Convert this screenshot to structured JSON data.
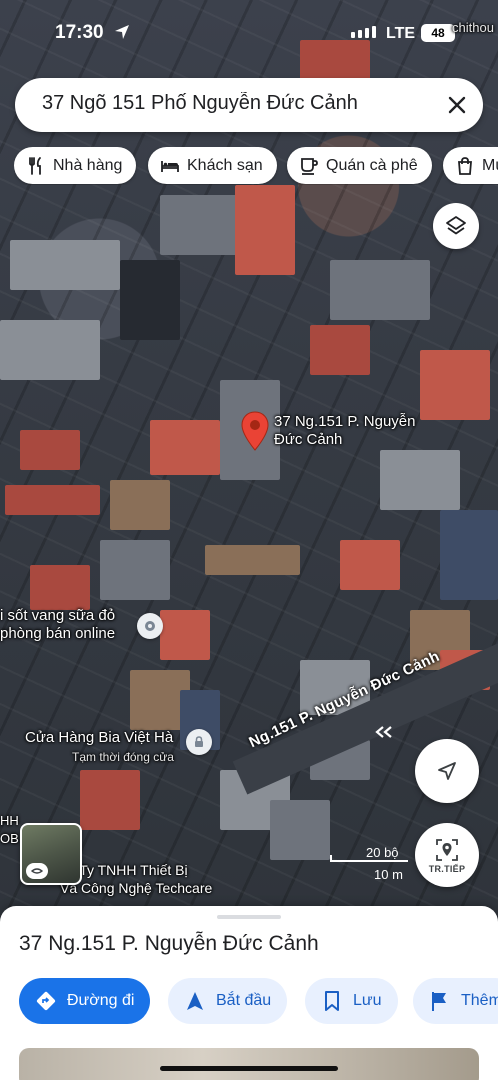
{
  "status_bar": {
    "time": "17:30",
    "network": "LTE",
    "battery": "48"
  },
  "search": {
    "query": "37 Ngõ 151 Phố Nguyễn Đức Cảnh"
  },
  "chips": [
    {
      "label": "Nhà hàng",
      "icon": "restaurant-icon"
    },
    {
      "label": "Khách sạn",
      "icon": "hotel-icon"
    },
    {
      "label": "Quán cà phê",
      "icon": "coffee-icon"
    },
    {
      "label": "Mu",
      "icon": "shopping-bag-icon"
    }
  ],
  "map": {
    "pin_label": "37 Ng.151 P. Nguyễn\nĐức Cảnh",
    "street_label": "Ng.151 P. Nguyễn Đức Cảnh",
    "poi_wine": "i sốt vang sữa đỏ\nphòng bán online",
    "poi_beer_name": "Cửa Hàng Bia Việt Hà",
    "poi_beer_status": "Tạm thời đóng cửa",
    "poi_techcare": "ng Ty TNHH Thiết Bị\nVà Công Nghệ Techcare",
    "poi_left_cut": "HH\nOB",
    "top_right_cut": "chithou"
  },
  "scale": {
    "imperial": "20 bộ",
    "metric": "10 m"
  },
  "buttons": {
    "follow_label": "TR.TIẾP"
  },
  "sheet": {
    "title": "37 Ng.151 P. Nguyễn Đức Cảnh",
    "actions": [
      {
        "label": "Đường đi",
        "icon": "directions-icon",
        "style": "primary"
      },
      {
        "label": "Bắt đầu",
        "icon": "navigation-arrow-icon",
        "style": "secondary"
      },
      {
        "label": "Lưu",
        "icon": "bookmark-icon",
        "style": "secondary"
      },
      {
        "label": "Thêm",
        "icon": "flag-icon",
        "style": "secondary"
      }
    ]
  },
  "colors": {
    "primary": "#1a73e8",
    "pin": "#ea4335",
    "secondary_bg": "#e8f0fe"
  }
}
